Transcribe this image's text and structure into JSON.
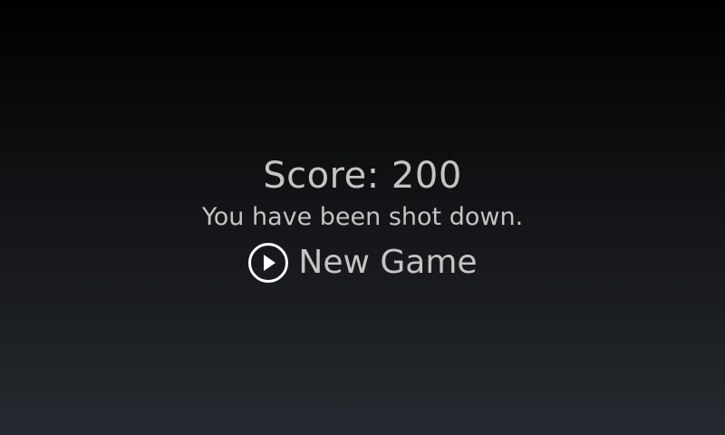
{
  "game_over": {
    "score_text": "Score: 200",
    "message": "You have been shot down.",
    "new_game_label": "New Game",
    "new_game_icon": "play-circle-icon"
  },
  "colors": {
    "text": "#c4c4c4",
    "icon": "#ffffff",
    "background_top": "#000000",
    "background_bottom": "#272a30"
  }
}
